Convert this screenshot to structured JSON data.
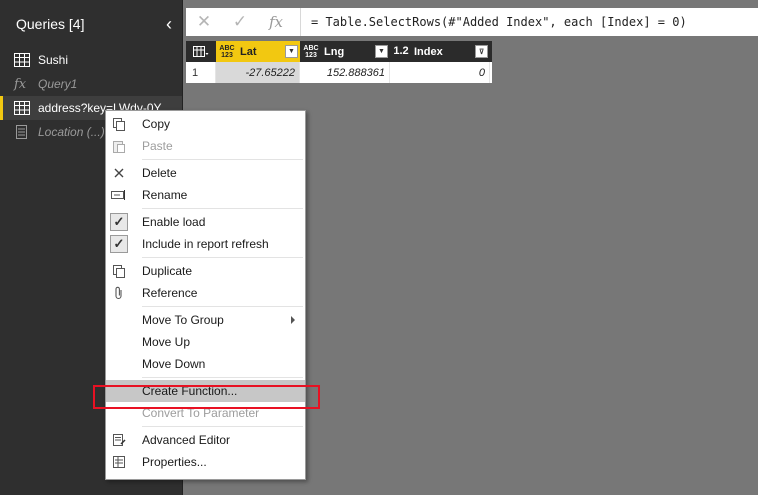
{
  "queries_pane": {
    "title": "Queries [4]",
    "collapse_glyph": "‹",
    "items": [
      {
        "label": "Sushi",
        "icon": "table-icon",
        "style": "normal"
      },
      {
        "label": "Query1",
        "icon": "fx-icon",
        "style": "muted"
      },
      {
        "label": "address?key=LWdv-0Y",
        "icon": "table-icon",
        "style": "selected"
      },
      {
        "label": "Location (...)",
        "icon": "document-icon",
        "style": "muted"
      }
    ]
  },
  "formula_bar": {
    "cancel_glyph": "✕",
    "confirm_glyph": "✓",
    "fx_label": "fx",
    "formula": "= Table.SelectRows(#\"Added Index\", each [Index] = 0)"
  },
  "grid": {
    "columns": [
      {
        "type_top": "ABC",
        "type_bottom": "123",
        "name": "Lat"
      },
      {
        "type_top": "ABC",
        "type_bottom": "123",
        "name": "Lng"
      },
      {
        "type_top": "1.2",
        "type_bottom": "",
        "name": "Index"
      }
    ],
    "rows": [
      {
        "num": "1",
        "lat": "-27.65222",
        "lng": "152.888361",
        "index": "0"
      }
    ]
  },
  "context_menu": {
    "copy": "Copy",
    "paste": "Paste",
    "delete": "Delete",
    "rename": "Rename",
    "enable_load": "Enable load",
    "include_refresh": "Include in report refresh",
    "duplicate": "Duplicate",
    "reference": "Reference",
    "move_to_group": "Move To Group",
    "move_up": "Move Up",
    "move_down": "Move Down",
    "create_function": "Create Function...",
    "convert_to_parameter": "Convert To Parameter",
    "advanced_editor": "Advanced Editor",
    "properties": "Properties..."
  },
  "colors": {
    "pane_bg": "#2f2f2f",
    "accent": "#f2c811",
    "highlight_box": "#e81123"
  }
}
